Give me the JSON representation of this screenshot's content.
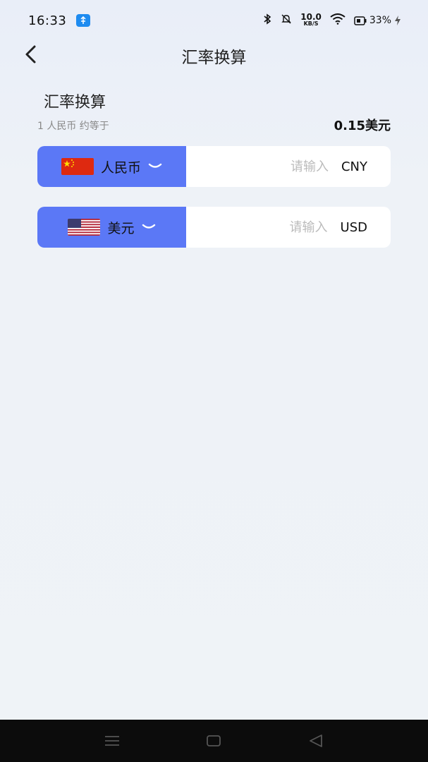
{
  "status_bar": {
    "time": "16:33",
    "net_speed_value": "10.0",
    "net_speed_unit": "KB/S",
    "battery": "33%"
  },
  "nav": {
    "title": "汇率换算"
  },
  "section": {
    "title": "汇率换算",
    "rate_desc": "1 人民币 约等于",
    "rate_value": "0.15美元"
  },
  "currencies": [
    {
      "name": "人民币",
      "placeholder": "请输入",
      "value": "",
      "code": "CNY",
      "flag": "china-flag-icon"
    },
    {
      "name": "美元",
      "placeholder": "请输入",
      "value": "",
      "code": "USD",
      "flag": "us-flag-icon"
    }
  ],
  "colors": {
    "accent": "#5b78f6",
    "background": "#eff3f7"
  }
}
